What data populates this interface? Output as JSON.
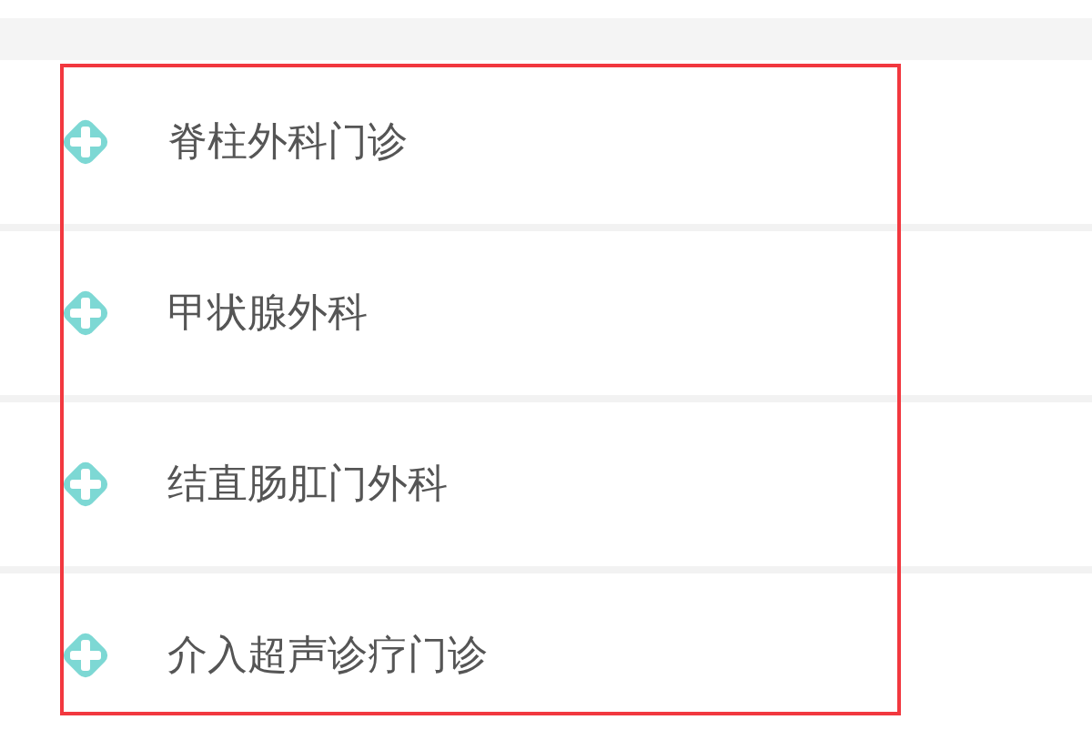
{
  "departments": [
    {
      "name": "脊柱外科门诊"
    },
    {
      "name": "甲状腺外科"
    },
    {
      "name": "结直肠肛门外科"
    },
    {
      "name": "介入超声诊疗门诊"
    }
  ]
}
